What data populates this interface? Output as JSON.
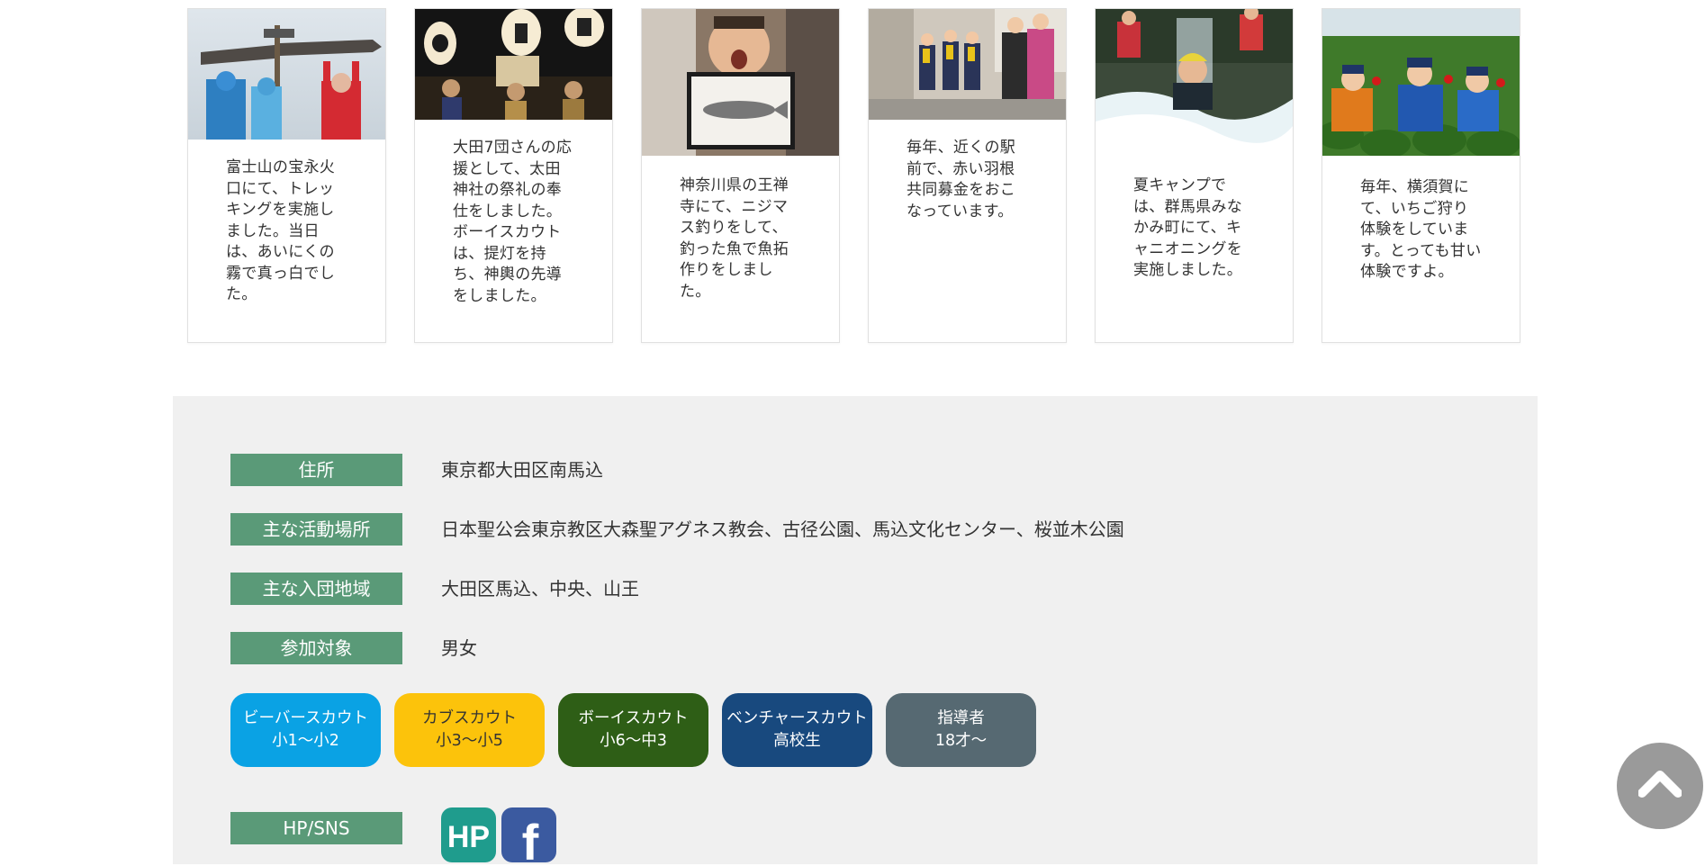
{
  "cards": [
    {
      "text": "富士山の宝永火口にて、トレッキングを実施しました。当日は、あいにくの霧で真っ白でした。"
    },
    {
      "text": "大田7団さんの応援として、太田神社の祭礼の奉仕をしました。ボーイスカウトは、提灯を持ち、神輿の先導をしました。"
    },
    {
      "text": "神奈川県の王禅寺にて、ニジマス釣りをして、釣った魚で魚拓作りをしました。"
    },
    {
      "text": "毎年、近くの駅前で、赤い羽根共同募金をおこなっています。"
    },
    {
      "text": "夏キャンプでは、群馬県みなかみ町にて、キャニオニングを実施しました。"
    },
    {
      "text": "毎年、横須賀にて、いちご狩り体験をしています。とっても甘い体験ですよ。"
    }
  ],
  "info": {
    "address": {
      "label": "住所",
      "value": "東京都大田区南馬込"
    },
    "places": {
      "label": "主な活動場所",
      "value": "日本聖公会東京教区大森聖アグネス教会、古径公園、馬込文化センター、桜並木公園"
    },
    "area": {
      "label": "主な入団地域",
      "value": "大田区馬込、中央、山王"
    },
    "target": {
      "label": "参加対象",
      "value": "男女"
    }
  },
  "tiers": [
    {
      "name": "ビーバースカウト",
      "age": "小1〜小2",
      "color": "#0aa2e4"
    },
    {
      "name": "カブスカウト",
      "age": "小3〜小5",
      "color": "#fcc30b"
    },
    {
      "name": "ボーイスカウト",
      "age": "小6〜中3",
      "color": "#2e5e16"
    },
    {
      "name": "ベンチャースカウト",
      "age": "高校生",
      "color": "#18497e"
    },
    {
      "name": "指導者",
      "age": "18才〜",
      "color": "#566972"
    }
  ],
  "sns": {
    "label": "HP/SNS",
    "hp_icon_text": "HP",
    "facebook_icon_text": "f",
    "hp_color": "#1f9c8d",
    "facebook_color": "#3b5aa0"
  },
  "icons": {
    "to_top": "chevron-up-icon",
    "hp": "hp-icon",
    "facebook": "facebook-icon"
  }
}
